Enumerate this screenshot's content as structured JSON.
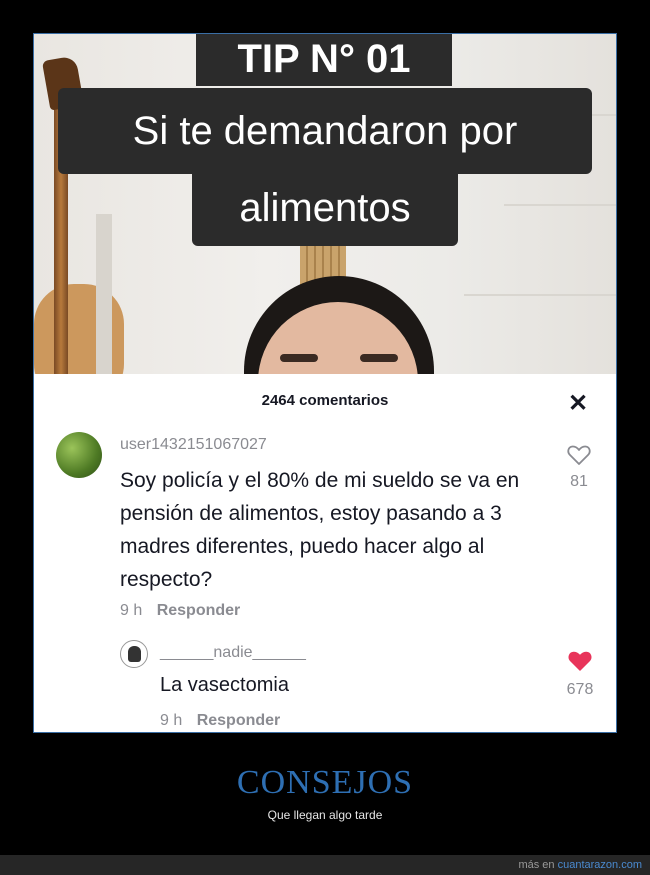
{
  "video": {
    "caption_line1": "TIP N° 01",
    "caption_line2": "Si te demandaron por",
    "caption_line3": "alimentos"
  },
  "comments_panel": {
    "header": "2464 comentarios",
    "close_glyph": "✕",
    "comment": {
      "username": "user1432151067027",
      "text": "Soy policía y el 80% de mi sueldo se va en pensión de alimentos, estoy pasando a 3 madres diferentes, puedo hacer algo al respecto?",
      "time": "9 h",
      "reply_label": "Responder",
      "likes": "81",
      "liked": false
    },
    "reply": {
      "username": "______nadie______",
      "text": "La vasectomia",
      "time": "9 h",
      "reply_label": "Responder",
      "likes": "678",
      "liked": true,
      "like_color": "#e8345a"
    }
  },
  "footer": {
    "title": "CONSEJOS",
    "subtitle": "Que llegan algo tarde",
    "source_prefix": "más en",
    "source_link": "cuantarazon.com",
    "title_color": "#2e6fb3"
  }
}
